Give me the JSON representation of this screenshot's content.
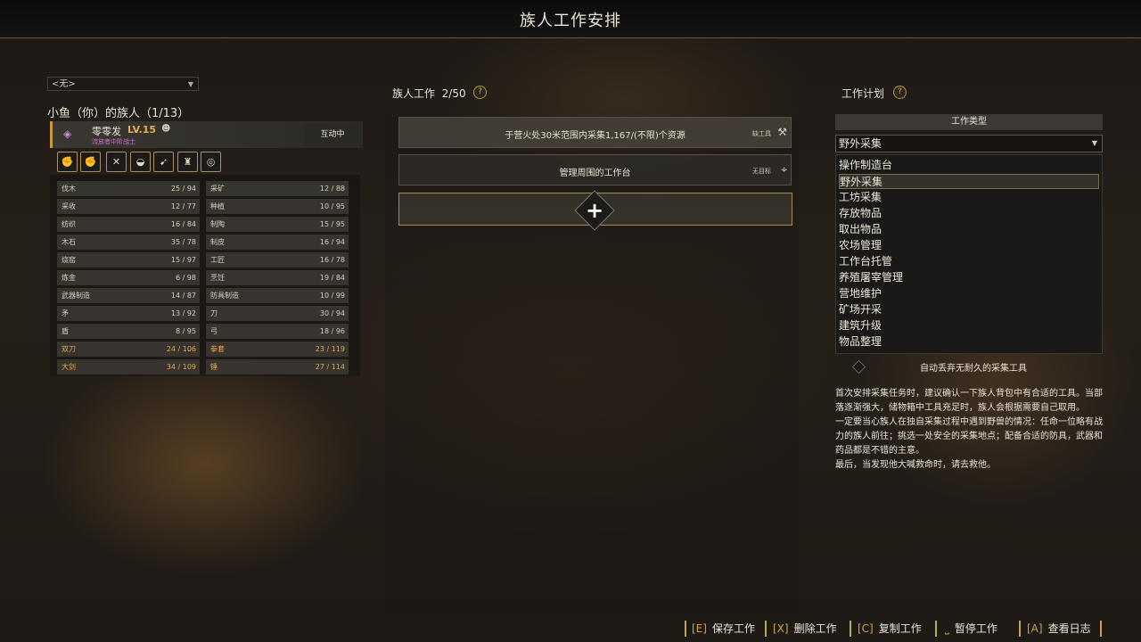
{
  "window": {
    "title": "族人工作安排"
  },
  "left": {
    "filter": {
      "value": "<无>"
    },
    "clan_title": "小鱼（你）的族人（1/13）",
    "member": {
      "name": "零零发",
      "level": "LV.15",
      "rank": "流放者中阶战士",
      "status": "互动中"
    },
    "traits": [
      "fist-icon",
      "fist-icon",
      "crossed-swords-icon",
      "bowl-icon",
      "runner-icon",
      "mask-icon",
      "spiral-icon"
    ],
    "skills": [
      {
        "name": "伐木",
        "value": "25 / 94"
      },
      {
        "name": "采矿",
        "value": "12 / 88"
      },
      {
        "name": "采收",
        "value": "12 / 77"
      },
      {
        "name": "种植",
        "value": "10 / 95"
      },
      {
        "name": "纺织",
        "value": "16 / 84"
      },
      {
        "name": "制陶",
        "value": "15 / 95"
      },
      {
        "name": "木石",
        "value": "35 / 78"
      },
      {
        "name": "制皮",
        "value": "16 / 94"
      },
      {
        "name": "烧窑",
        "value": "15 / 97"
      },
      {
        "name": "工匠",
        "value": "16 / 78"
      },
      {
        "name": "炼金",
        "value": "6 / 98"
      },
      {
        "name": "烹饪",
        "value": "19 / 84"
      },
      {
        "name": "武器制造",
        "value": "14 / 87"
      },
      {
        "name": "防具制造",
        "value": "10 / 99"
      },
      {
        "name": "矛",
        "value": "13 / 92"
      },
      {
        "name": "刀",
        "value": "30 / 94"
      },
      {
        "name": "盾",
        "value": "8 / 95"
      },
      {
        "name": "弓",
        "value": "18 / 96"
      },
      {
        "name": "双刀",
        "value": "24 / 106"
      },
      {
        "name": "拳套",
        "value": "23 / 119"
      },
      {
        "name": "大剑",
        "value": "34 / 109"
      },
      {
        "name": "锤",
        "value": "27 / 114"
      }
    ]
  },
  "middle": {
    "header": "族人工作",
    "count": "2/50",
    "jobs": [
      {
        "text": "于营火处30米范围内采集1,167/(不限)个资源",
        "tag": "缺工具"
      },
      {
        "text": "管理周围的工作台",
        "tag": "无目标"
      }
    ]
  },
  "right": {
    "header": "工作计划",
    "type_header": "工作类型",
    "selected_type": "野外采集",
    "types": [
      "操作制造台",
      "野外采集",
      "工坊采集",
      "存放物品",
      "取出物品",
      "农场管理",
      "工作台托管",
      "养殖屠宰管理",
      "营地维护",
      "矿场开采",
      "建筑升级",
      "物品整理"
    ],
    "auto_discard": "自动丢弃无耐久的采集工具",
    "description": [
      "首次安排采集任务时，建议确认一下族人背包中有合适的工具。当部落逐渐强大，储物箱中工具充足时，族人会根据需要自己取用。",
      "一定要当心族人在独自采集过程中遇到野兽的情况：任命一位略有战力的族人前往；挑选一处安全的采集地点；配备合适的防具，武器和药品都是不错的主意。",
      "最后，当发现他大喊救命时，请去救他。"
    ]
  },
  "bottom": {
    "buttons": [
      {
        "key": "[E]",
        "label": "保存工作"
      },
      {
        "key": "[X]",
        "label": "删除工作"
      },
      {
        "key": "[C]",
        "label": "复制工作"
      },
      {
        "key": "⎵",
        "label": "暂停工作"
      },
      {
        "key": "[A]",
        "label": "查看日志"
      }
    ]
  },
  "colors": {
    "accent": "#d2a34c",
    "highlight_skill": "#e7a844",
    "rank": "#d46fd8"
  }
}
